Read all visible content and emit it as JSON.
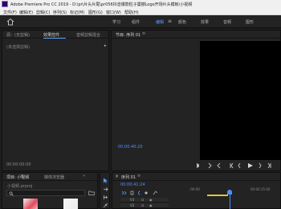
{
  "app": {
    "title": "Adobe Premiere Pro CC 2019 - D:\\pr\\片头片尾\\pr056抖音爆款粒子震撼Logo开场片头模板\\小视频",
    "brand_color": "#9a6cff"
  },
  "menubar": {
    "items": [
      "文件(F)",
      "编辑(E)",
      "剪辑(C)",
      "序列(S)",
      "标记(M)",
      "图形(G)",
      "窗口(W)",
      "帮助(H)"
    ]
  },
  "workspaces": {
    "tabs": [
      "学习",
      "组件",
      "编辑",
      "颜色",
      "效果",
      "音频",
      "图形"
    ],
    "active": "编辑",
    "overflow_icon": "≡"
  },
  "left_panel": {
    "tabs": [
      "源：(无剪辑)",
      "效果控件",
      "音频剪辑混合"
    ],
    "active_tab": "效果控件",
    "selection_msg": "(未选择剪辑)",
    "timecode": "00:00:00:00"
  },
  "program_monitor": {
    "tab": "节目: 序列 01",
    "timecode": "00:00:40:20",
    "accent": "#4f8fff"
  },
  "project_panel": {
    "tabs": [
      "项目: 小视频",
      "媒体浏览器"
    ],
    "filename": "小视频.prproj",
    "search_placeholder": ""
  },
  "timeline": {
    "tab": "序列 01",
    "timecode": "00:00:41:24",
    "ruler_start": ":00:00",
    "ruler_mid": "00:00:15:00",
    "tracks": [
      "V3",
      "V2",
      "V1"
    ],
    "playhead_color": "#4f8fff",
    "inrange_color": "#e3c33a"
  }
}
